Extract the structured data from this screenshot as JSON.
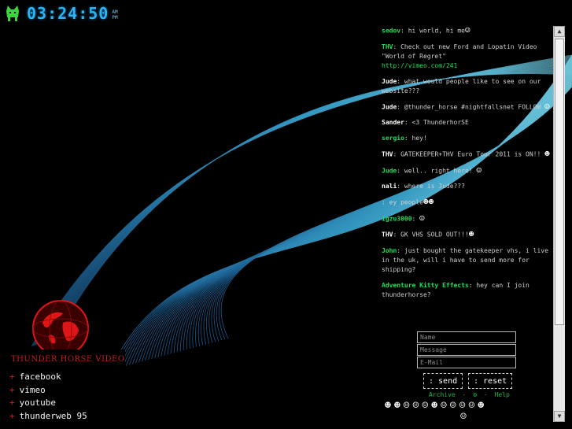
{
  "header": {
    "time": "03:24:50",
    "am": "AM",
    "pm": "PM"
  },
  "chat": {
    "messages": [
      {
        "user": "sedov",
        "user_color": "green",
        "text": "hi world, hi me"
      },
      {
        "user": "THV",
        "user_color": "green",
        "text": "Check out new Ford and Lopatin Video \"World of Regret\"",
        "link": "http://vimeo.com/241"
      },
      {
        "user": "Jude",
        "user_color": "white",
        "text": "what would people like to see on our website???"
      },
      {
        "user": "Jude",
        "user_color": "white",
        "text": "@thunder_horse #nightfallsnet FOLLOW"
      },
      {
        "user": "Sander",
        "user_color": "white",
        "text": "<3 ThunderhorSE"
      },
      {
        "user": "sergio",
        "user_color": "green",
        "text": "hey!"
      },
      {
        "user": "THV",
        "user_color": "white",
        "text": "GATEKEEPER+THV Euro Tour 2011 is ON!!"
      },
      {
        "user": "Jude",
        "user_color": "green",
        "text": "well.. right here!"
      },
      {
        "user": "nali",
        "user_color": "white",
        "text": "where is Jude???"
      },
      {
        "user": "",
        "user_color": "white",
        "text": ": ey people"
      },
      {
        "user": "igzu3000",
        "user_color": "green",
        "text": ""
      },
      {
        "user": "THV",
        "user_color": "white",
        "text": "GK VHS SOLD OUT!!!"
      },
      {
        "user": "John",
        "user_color": "green",
        "text": "just bought the gatekeeper vhs, i live in the uk, will i have to send more for shipping?"
      },
      {
        "user": "Adventure Kitty Effects",
        "user_color": "green",
        "text": "hey can I join thunderhorse?"
      }
    ]
  },
  "form": {
    "name_placeholder": "Name",
    "message_placeholder": "Message",
    "email_placeholder": "E-Mail",
    "send_label": ": send",
    "reset_label": ": reset",
    "archive_label": "Archive",
    "separator": "-",
    "help_label": "Help"
  },
  "sidebar": {
    "brand": "THUNDER HORSE VIDEO",
    "links": [
      "facebook",
      "vimeo",
      "youtube",
      "thunderweb 95"
    ]
  },
  "colors": {
    "accent_blue": "#29b6f6",
    "brand_red": "#d21f1f",
    "chat_green": "#19e05b"
  }
}
